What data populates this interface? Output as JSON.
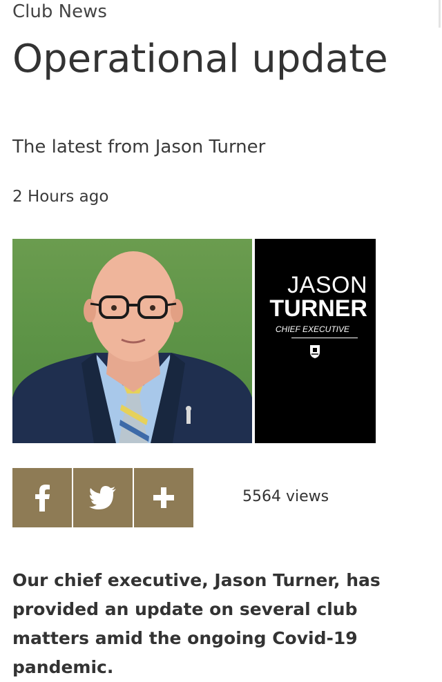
{
  "article": {
    "category": "Club News",
    "title": "Operational update",
    "subtitle": "The latest from Jason Turner",
    "timestamp": "2 Hours ago",
    "lead": "Our chief executive, Jason Turner, has provided an update on several club matters amid the ongoing Covid-19 pandemic."
  },
  "hero": {
    "name_first": "JASON",
    "name_last": "TURNER",
    "role": "CHIEF EXECUTIVE"
  },
  "share": {
    "buttons": [
      {
        "icon": "facebook-icon"
      },
      {
        "icon": "twitter-icon"
      },
      {
        "icon": "plus-icon"
      }
    ],
    "views": "5564 views"
  },
  "colors": {
    "share_button_bg": "#8e7b55",
    "name_panel_bg": "#000000",
    "text": "#333333"
  }
}
